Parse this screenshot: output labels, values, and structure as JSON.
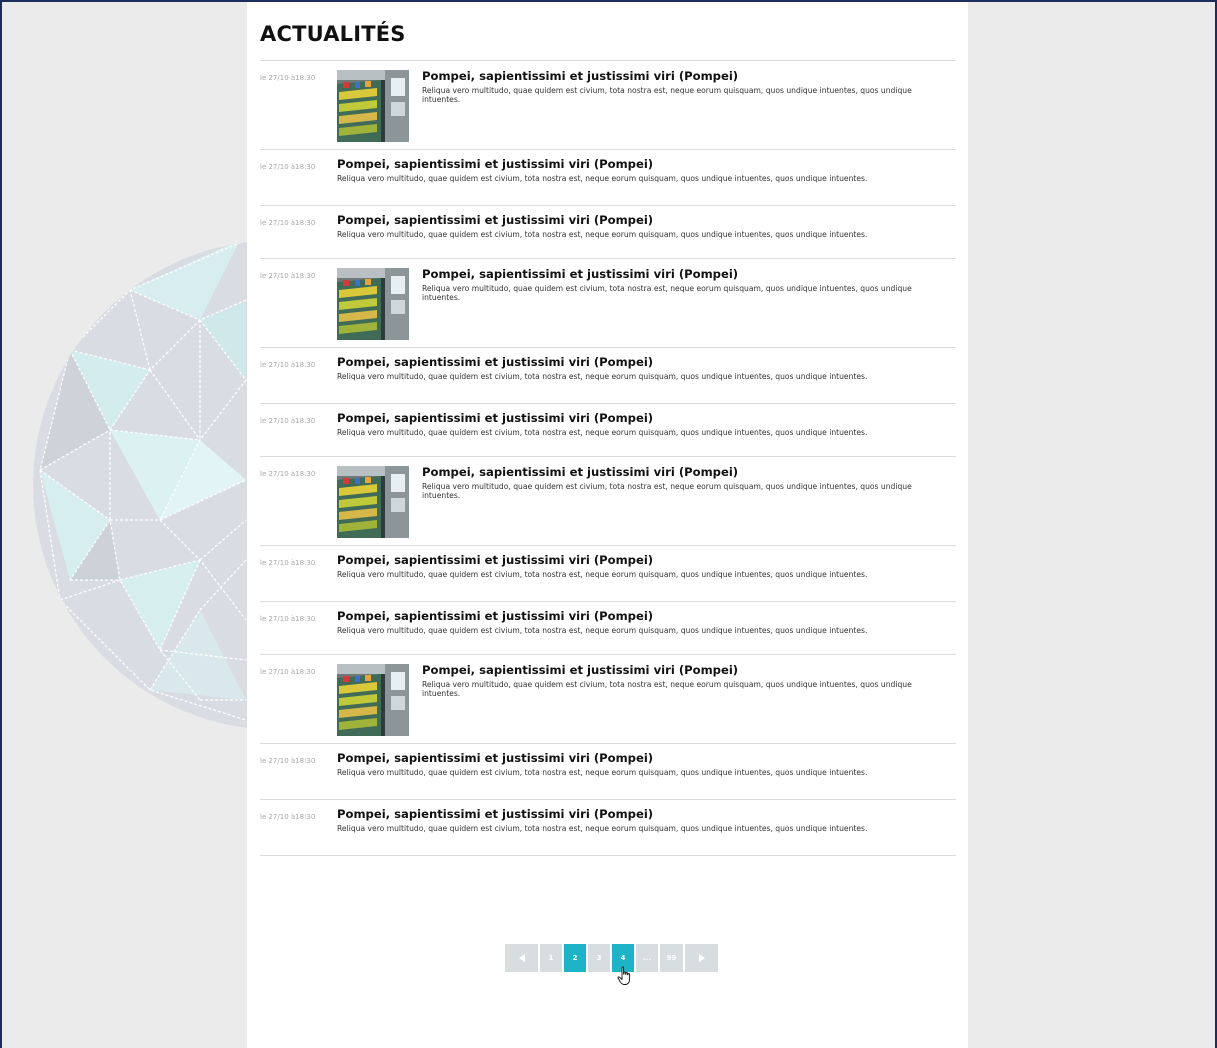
{
  "page": {
    "title": "ACTUALITÉS"
  },
  "news": [
    {
      "date": "le 27/10 à18:30",
      "title": "Pompei, sapientissimi et justissimi viri (Pompei)",
      "excerpt": "Reliqua vero multitudo, quae quidem est civium, tota nostra est, neque eorum quisquam, quos undique intuentes, quos undique intuentes.",
      "has_image": true
    },
    {
      "date": "le 27/10 à18:30",
      "title": "Pompei, sapientissimi et justissimi viri (Pompei)",
      "excerpt": "Reliqua vero multitudo, quae quidem est civium, tota nostra est, neque eorum quisquam, quos undique intuentes, quos undique intuentes.",
      "has_image": false
    },
    {
      "date": "le 27/10 à18:30",
      "title": "Pompei, sapientissimi et justissimi viri (Pompei)",
      "excerpt": "Reliqua vero multitudo, quae quidem est civium, tota nostra est, neque eorum quisquam, quos undique intuentes, quos undique intuentes.",
      "has_image": false
    },
    {
      "date": "le 27/10 à18:30",
      "title": "Pompei, sapientissimi et justissimi viri (Pompei)",
      "excerpt": "Reliqua vero multitudo, quae quidem est civium, tota nostra est, neque eorum quisquam, quos undique intuentes, quos undique intuentes.",
      "has_image": true
    },
    {
      "date": "le 27/10 à18:30",
      "title": "Pompei, sapientissimi et justissimi viri (Pompei)",
      "excerpt": "Reliqua vero multitudo, quae quidem est civium, tota nostra est, neque eorum quisquam, quos undique intuentes, quos undique intuentes.",
      "has_image": false
    },
    {
      "date": "le 27/10 à18:30",
      "title": "Pompei, sapientissimi et justissimi viri (Pompei)",
      "excerpt": "Reliqua vero multitudo, quae quidem est civium, tota nostra est, neque eorum quisquam, quos undique intuentes, quos undique intuentes.",
      "has_image": false
    },
    {
      "date": "le 27/10 à18:30",
      "title": "Pompei, sapientissimi et justissimi viri (Pompei)",
      "excerpt": "Reliqua vero multitudo, quae quidem est civium, tota nostra est, neque eorum quisquam, quos undique intuentes, quos undique intuentes.",
      "has_image": true
    },
    {
      "date": "le 27/10 à18:30",
      "title": "Pompei, sapientissimi et justissimi viri (Pompei)",
      "excerpt": "Reliqua vero multitudo, quae quidem est civium, tota nostra est, neque eorum quisquam, quos undique intuentes, quos undique intuentes.",
      "has_image": false
    },
    {
      "date": "le 27/10 à18:30",
      "title": "Pompei, sapientissimi et justissimi viri (Pompei)",
      "excerpt": "Reliqua vero multitudo, quae quidem est civium, tota nostra est, neque eorum quisquam, quos undique intuentes, quos undique intuentes.",
      "has_image": false
    },
    {
      "date": "le 27/10 à18:30",
      "title": "Pompei, sapientissimi et justissimi viri (Pompei)",
      "excerpt": "Reliqua vero multitudo, quae quidem est civium, tota nostra est, neque eorum quisquam, quos undique intuentes, quos undique intuentes.",
      "has_image": true
    },
    {
      "date": "le 27/10 à18:30",
      "title": "Pompei, sapientissimi et justissimi viri (Pompei)",
      "excerpt": "Reliqua vero multitudo, quae quidem est civium, tota nostra est, neque eorum quisquam, quos undique intuentes, quos undique intuentes.",
      "has_image": false
    },
    {
      "date": "le 27/10 à18:30",
      "title": "Pompei, sapientissimi et justissimi viri (Pompei)",
      "excerpt": "Reliqua vero multitudo, quae quidem est civium, tota nostra est, neque eorum quisquam, quos undique intuentes, quos undique intuentes.",
      "has_image": false
    }
  ],
  "pagination": {
    "prev_icon": "triangle-left-icon",
    "next_icon": "triangle-right-icon",
    "pages": [
      "1",
      "2",
      "3",
      "4",
      "...",
      "99"
    ],
    "current_pages": [
      "2",
      "4"
    ]
  },
  "cursor": {
    "icon": "hand-pointer-icon"
  },
  "colors": {
    "accent": "#1fb3c7",
    "pagination_inactive": "#d8dde0",
    "background": "#ebebeb",
    "frame": "#1f2d5c"
  }
}
